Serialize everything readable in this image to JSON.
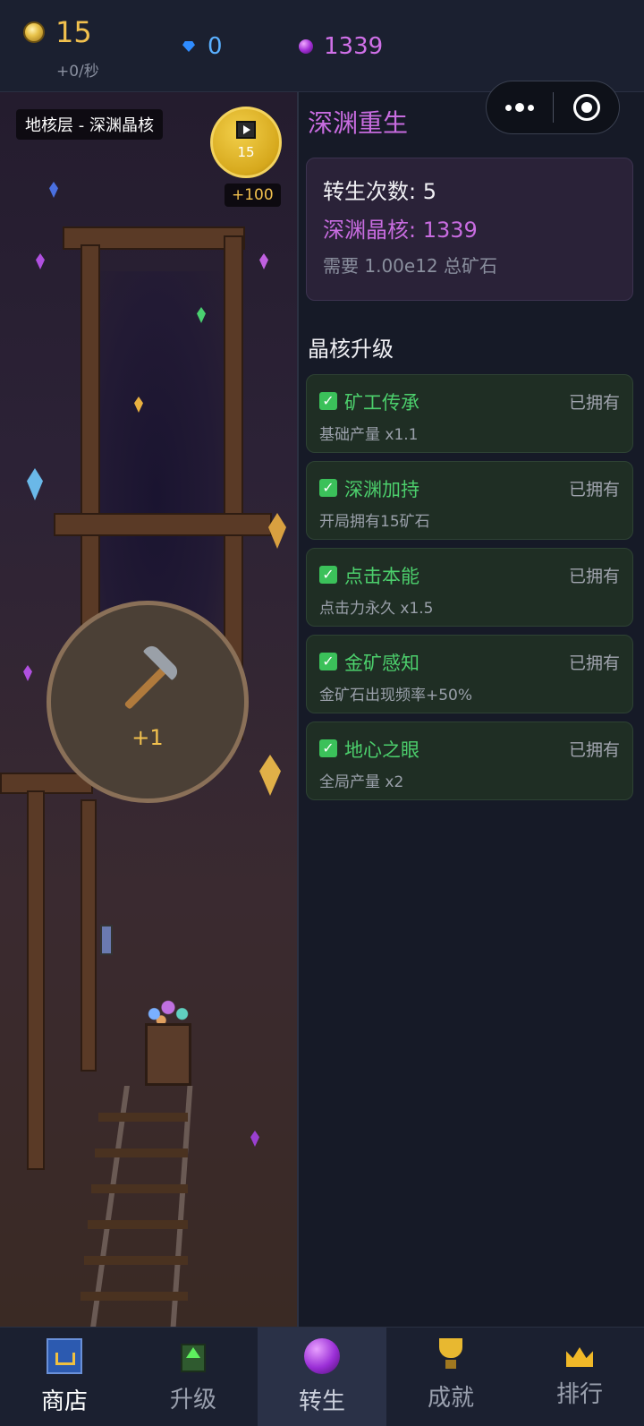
{
  "resources": {
    "gold": {
      "value": "15",
      "rate": "+0/秒",
      "icon": "gold-ore-icon",
      "color": "#f2c14e"
    },
    "gems": {
      "value": "0",
      "icon": "diamond-icon",
      "color": "#5ab0ff"
    },
    "abyss_cores": {
      "value": "1339",
      "icon": "purple-orb-icon",
      "color": "#d070e8"
    }
  },
  "scene": {
    "zone_label": "地核层 - 深渊晶核",
    "video_reward": {
      "count": "15",
      "bonus": "+100"
    },
    "mine_button": {
      "gain": "+1"
    }
  },
  "rebirth": {
    "title": "深渊重生",
    "count_text": "转生次数: 5",
    "cores_text": "深渊晶核: 1339",
    "requirement_text": "需要 1.00e12 总矿石"
  },
  "upgrades": {
    "title": "晶核升级",
    "items": [
      {
        "name": "矿工传承",
        "desc": "基础产量 x1.1",
        "status": "已拥有"
      },
      {
        "name": "深渊加持",
        "desc": "开局拥有15矿石",
        "status": "已拥有"
      },
      {
        "name": "点击本能",
        "desc": "点击力永久 x1.5",
        "status": "已拥有"
      },
      {
        "name": "金矿感知",
        "desc": "金矿石出现频率+50%",
        "status": "已拥有"
      },
      {
        "name": "地心之眼",
        "desc": "全局产量 x2",
        "status": "已拥有"
      }
    ]
  },
  "tabs": [
    {
      "label": "商店",
      "icon": "shop-cart-icon"
    },
    {
      "label": "升级",
      "icon": "upgrade-arrow-icon"
    },
    {
      "label": "转生",
      "icon": "purple-orb-icon",
      "active": true
    },
    {
      "label": "成就",
      "icon": "trophy-icon"
    },
    {
      "label": "排行",
      "icon": "crown-icon"
    }
  ],
  "colors": {
    "accent_purple": "#c86ce0",
    "owned_green": "#4ccf6c",
    "gold": "#f2c14e"
  }
}
